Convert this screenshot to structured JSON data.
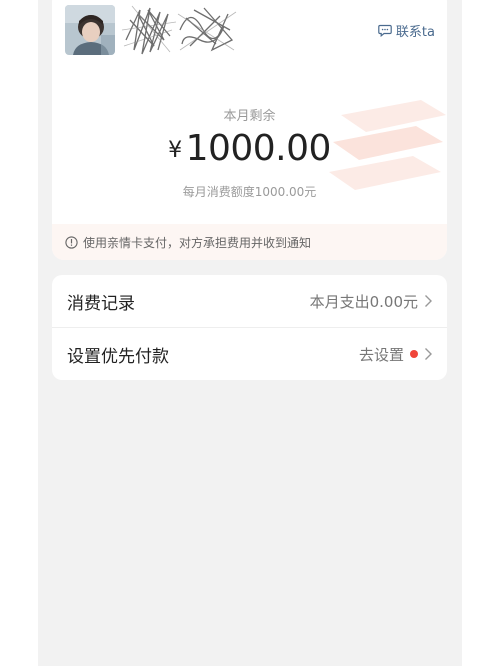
{
  "header": {
    "contact_label": "联系ta",
    "contact_icon": "chat-bubble-icon"
  },
  "balance": {
    "label": "本月剩余",
    "currency": "¥",
    "amount": "1000.00",
    "quota_text": "每月消费额度1000.00元"
  },
  "notice": {
    "icon": "info-circle-icon",
    "text": "使用亲情卡支付，对方承担费用并收到通知"
  },
  "list": {
    "items": [
      {
        "label": "消费记录",
        "value": "本月支出0.00元",
        "badge": false
      },
      {
        "label": "设置优先付款",
        "value": "去设置",
        "badge": true
      }
    ]
  },
  "colors": {
    "background": "#f2f2f2",
    "card": "#ffffff",
    "link": "#4a6a8e",
    "badge": "#f0453a",
    "notice_bg": "#fdf6f3"
  }
}
